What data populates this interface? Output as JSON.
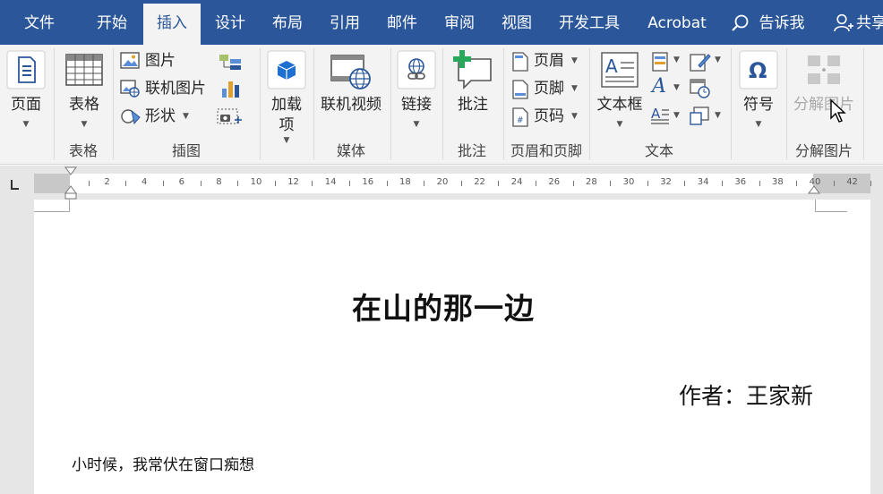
{
  "tabs": [
    "文件",
    "开始",
    "插入",
    "设计",
    "布局",
    "引用",
    "邮件",
    "审阅",
    "视图",
    "开发工具",
    "Acrobat"
  ],
  "active_tab": "插入",
  "tell_me": "告诉我",
  "share": "共享",
  "ribbon": {
    "pages": {
      "label": "页面"
    },
    "tables": {
      "button": "表格",
      "group": "表格"
    },
    "illustrations": {
      "picture": "图片",
      "online_picture": "联机图片",
      "shapes": "形状",
      "group": "插图"
    },
    "addins": {
      "label_line1": "加载",
      "label_line2": "项"
    },
    "media": {
      "online_video": "联机视频",
      "group": "媒体"
    },
    "links": {
      "label": "链接"
    },
    "comments": {
      "button": "批注",
      "group": "批注"
    },
    "header_footer": {
      "header": "页眉",
      "footer": "页脚",
      "page_number": "页码",
      "group": "页眉和页脚"
    },
    "text": {
      "textbox": "文本框",
      "group": "文本"
    },
    "symbols": {
      "label": "符号"
    },
    "decompose": {
      "button": "分解图片",
      "group": "分解图片"
    }
  },
  "ruler": {
    "ticks": [
      "2",
      "4",
      "6",
      "8",
      "10",
      "12",
      "14",
      "16",
      "18",
      "20",
      "22",
      "24",
      "26",
      "28",
      "30",
      "32",
      "34",
      "36",
      "38",
      "40",
      "42"
    ]
  },
  "document": {
    "title": "在山的那一边",
    "author": "作者：王家新",
    "paragraph": "小时候，我常伏在窗口痴想"
  },
  "colors": {
    "word_blue": "#2b579a",
    "ribbon_bg": "#f3f3f3",
    "workspace_bg": "#e6e6e6"
  }
}
